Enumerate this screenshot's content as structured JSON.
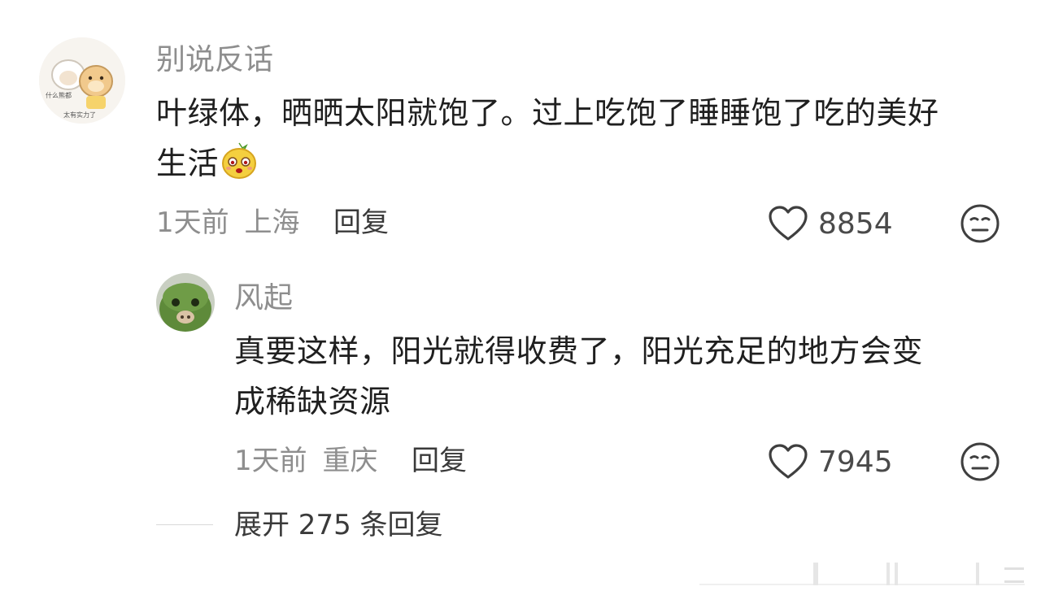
{
  "comment": {
    "username": "别说反话",
    "avatar_text_top": "什么熊都",
    "avatar_text_bottom": "太有实力了",
    "text_line1": "叶绿体，晒晒太阳就饱了。过上吃饱了睡睡饱了吃的美好",
    "text_line2": "生活",
    "emoji_icon": "smiling-lemon-emoji",
    "time": "1天前",
    "location": "上海",
    "reply_label": "回复",
    "likes": "8854"
  },
  "reply": {
    "username": "风起",
    "text_line1": "真要这样，阳光就得收费了，阳光充足的地方会变",
    "text_line2": "成稀缺资源",
    "time": "1天前",
    "location": "重庆",
    "reply_label": "回复",
    "likes": "7945"
  },
  "expand": {
    "label": "展开 275 条回复"
  }
}
